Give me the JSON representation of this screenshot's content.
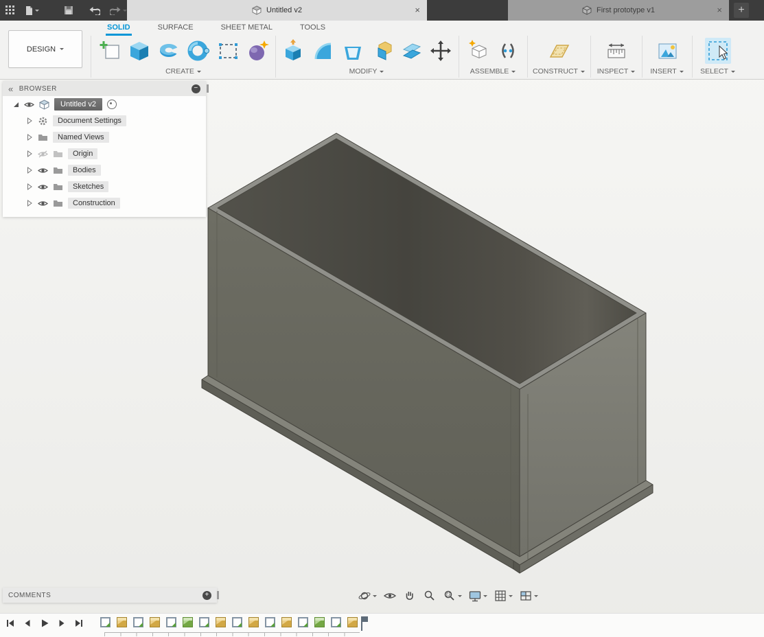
{
  "colors": {
    "accent_blue": "#0696d7",
    "titlebar_bg": "#3c3c3c",
    "ribbon_bg": "#f2f2f1",
    "viewport_bg": "#f5f5f3",
    "model_near_face": "#67675e",
    "model_right_face": "#7b7b72",
    "model_rim": "#90908a",
    "model_interior_dark": "#45443e",
    "model_flange": "#63635b"
  },
  "titlebar": {
    "menu_icons": [
      "app-grid-icon",
      "file-icon",
      "save-icon",
      "undo-icon",
      "redo-icon"
    ],
    "tabs": [
      {
        "label": "Untitled v2",
        "close": "×",
        "active": true
      },
      {
        "label": "First prototype v1",
        "close": "×",
        "active": false
      }
    ],
    "new_tab": "+"
  },
  "ribbon": {
    "workspace": "DESIGN",
    "active_tab": "SOLID",
    "tabs": [
      {
        "label": "SOLID"
      },
      {
        "label": "SURFACE"
      },
      {
        "label": "SHEET METAL"
      },
      {
        "label": "TOOLS"
      }
    ],
    "groups": [
      {
        "label": "CREATE",
        "icons": [
          "create-sketch-icon",
          "box-primitive-icon",
          "revolve-icon",
          "torus-icon",
          "pattern-icon",
          "coil-icon"
        ]
      },
      {
        "label": "MODIFY",
        "icons": [
          "press-pull-icon",
          "fillet-icon",
          "shell-icon",
          "combine-icon",
          "offset-face-icon",
          "move-icon"
        ]
      },
      {
        "label": "ASSEMBLE",
        "icons": [
          "new-component-icon",
          "joint-icon"
        ]
      },
      {
        "label": "CONSTRUCT",
        "icons": [
          "construction-plane-icon"
        ]
      },
      {
        "label": "INSPECT",
        "icons": [
          "measure-icon"
        ]
      },
      {
        "label": "INSERT",
        "icons": [
          "insert-image-icon"
        ]
      },
      {
        "label": "SELECT",
        "icons": [
          "select-cursor-icon"
        ]
      }
    ]
  },
  "browser": {
    "header": {
      "title": "BROWSER",
      "collapse_icon": "«",
      "minimize_icon": "−"
    },
    "items": [
      {
        "label": "Untitled v2",
        "icon": "component-cube-icon",
        "eye": "visible",
        "expanded": true,
        "selected": true,
        "trailing_icon": "activate-radio-icon"
      },
      {
        "label": "Document Settings",
        "icon": "gear-icon",
        "eye": "none",
        "expanded": false,
        "selected": false
      },
      {
        "label": "Named Views",
        "icon": "folder-icon",
        "eye": "none",
        "expanded": false,
        "selected": false
      },
      {
        "label": "Origin",
        "icon": "folder-icon",
        "eye": "hidden",
        "expanded": false,
        "selected": false
      },
      {
        "label": "Bodies",
        "icon": "folder-icon",
        "eye": "visible",
        "expanded": false,
        "selected": false
      },
      {
        "label": "Sketches",
        "icon": "folder-icon",
        "eye": "visible",
        "expanded": false,
        "selected": false
      },
      {
        "label": "Construction",
        "icon": "folder-icon",
        "eye": "visible",
        "expanded": false,
        "selected": false
      }
    ]
  },
  "viewport": {
    "model": "open rectangular box with base flange, isometric view, olive-gray shaded"
  },
  "comments": {
    "title": "COMMENTS",
    "expand_icon": "+"
  },
  "navbar": {
    "buttons": [
      {
        "icon": "orbit-icon",
        "dropdown": true
      },
      {
        "icon": "look-at-icon",
        "dropdown": false
      },
      {
        "icon": "pan-hand-icon",
        "dropdown": false
      },
      {
        "icon": "zoom-icon",
        "dropdown": false
      },
      {
        "icon": "window-zoom-icon",
        "dropdown": true
      },
      {
        "icon": "display-settings-icon",
        "dropdown": true
      },
      {
        "icon": "grid-settings-icon",
        "dropdown": true
      },
      {
        "icon": "viewports-icon",
        "dropdown": true
      }
    ]
  },
  "timeline": {
    "playback_icons": [
      "skip-to-start-icon",
      "step-back-icon",
      "play-icon",
      "step-forward-icon",
      "skip-to-end-icon"
    ],
    "features": [
      {
        "type": "sketch"
      },
      {
        "type": "extrude"
      },
      {
        "type": "sketch"
      },
      {
        "type": "extrude"
      },
      {
        "type": "sketch"
      },
      {
        "type": "extrude-green"
      },
      {
        "type": "sketch"
      },
      {
        "type": "extrude"
      },
      {
        "type": "sketch"
      },
      {
        "type": "extrude"
      },
      {
        "type": "sketch"
      },
      {
        "type": "extrude"
      },
      {
        "type": "sketch"
      },
      {
        "type": "extrude-green"
      },
      {
        "type": "sketch"
      },
      {
        "type": "extrude"
      }
    ],
    "playhead": "end"
  }
}
